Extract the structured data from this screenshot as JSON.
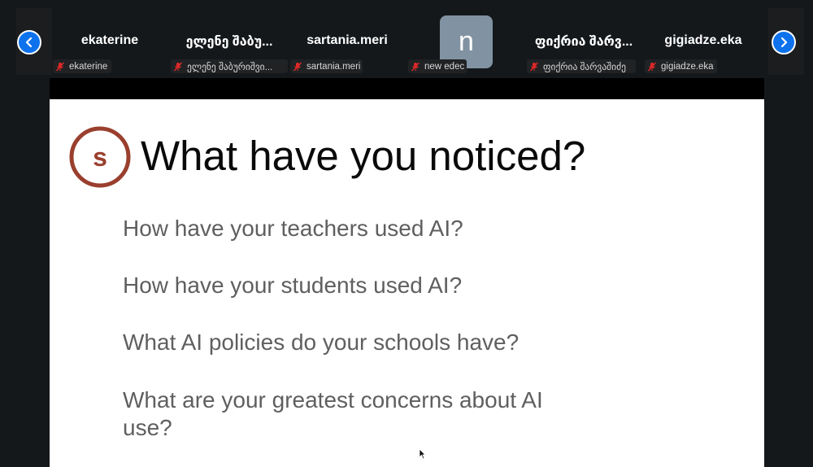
{
  "participants": {
    "prev_label": "Previous page",
    "next_label": "Next page",
    "tiles": [
      {
        "display_name": "ekaterine",
        "label": "ekaterine"
      },
      {
        "display_name": "ელენე შაბუ...",
        "label": "ელენე შაბურიშვი..."
      },
      {
        "display_name": "sartania.meri",
        "label": "sartania.meri"
      },
      {
        "display_name": "",
        "avatar_initial": "n",
        "label": "new edec"
      },
      {
        "display_name": "ფიქრია შარვ...",
        "label": "ფიქრია შარვაშიძე"
      },
      {
        "display_name": "gigiadze.eka",
        "label": "gigiadze.eka"
      }
    ],
    "mic_icon": "mic-muted-icon",
    "colors": {
      "nav_button": "#0e72ed",
      "mic_muted": "#e02828",
      "avatar": "#8193a2"
    }
  },
  "slide": {
    "logo_letter": "s",
    "title": "What have you noticed?",
    "questions": [
      "How have your teachers used AI?",
      "How have your students used AI?",
      "What AI policies do your schools have?",
      "What are your greatest concerns about AI use?"
    ],
    "colors": {
      "logo": "#9a3f2e",
      "title": "#0a0a0a",
      "questions": "#5f5f5f"
    }
  }
}
